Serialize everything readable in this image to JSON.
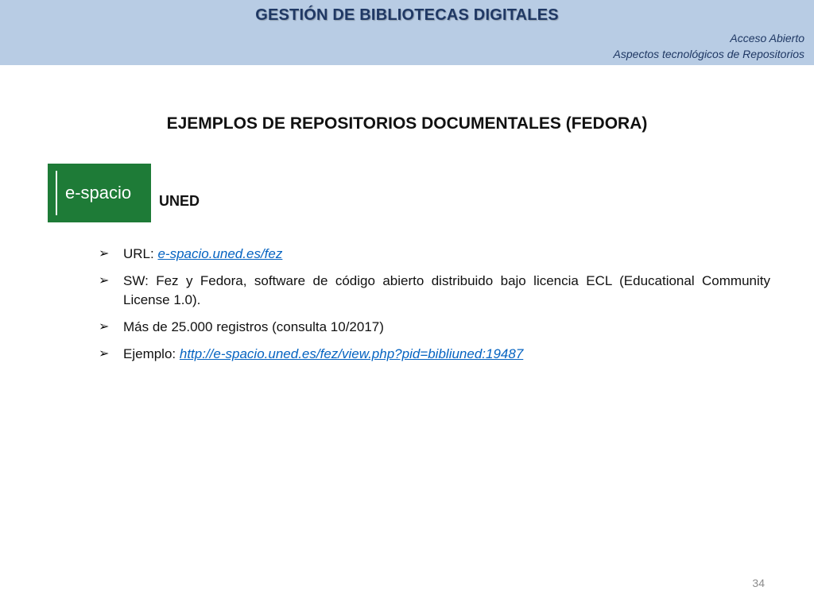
{
  "header": {
    "title": "GESTIÓN DE BIBLIOTECAS DIGITALES",
    "subtitle_1": "Acceso Abierto",
    "subtitle_2": "Aspectos tecnológicos de Repositorios",
    "background": "#b8cce4",
    "title_color": "#1f3864"
  },
  "slide": {
    "title": "EJEMPLOS DE REPOSITORIOS DOCUMENTALES (FEDORA)",
    "logo_text": "e-spacio",
    "logo_color": "#1e7b37",
    "organization": "UNED",
    "bullet_icon": "arrow-bullet-icon",
    "bullets": [
      {
        "label": "URL: ",
        "link": "e-spacio.uned.es/fez"
      },
      {
        "text": "SW: Fez y Fedora, software de código abierto distribuido bajo licencia ECL (Educational Community License 1.0)."
      },
      {
        "text": "Más de 25.000 registros (consulta 10/2017)"
      },
      {
        "label": "Ejemplo: ",
        "link": "http://e-spacio.uned.es/fez/view.php?pid=bibliuned:19487"
      }
    ],
    "link_color": "#0563c1"
  },
  "footer": {
    "page_number": "34"
  }
}
